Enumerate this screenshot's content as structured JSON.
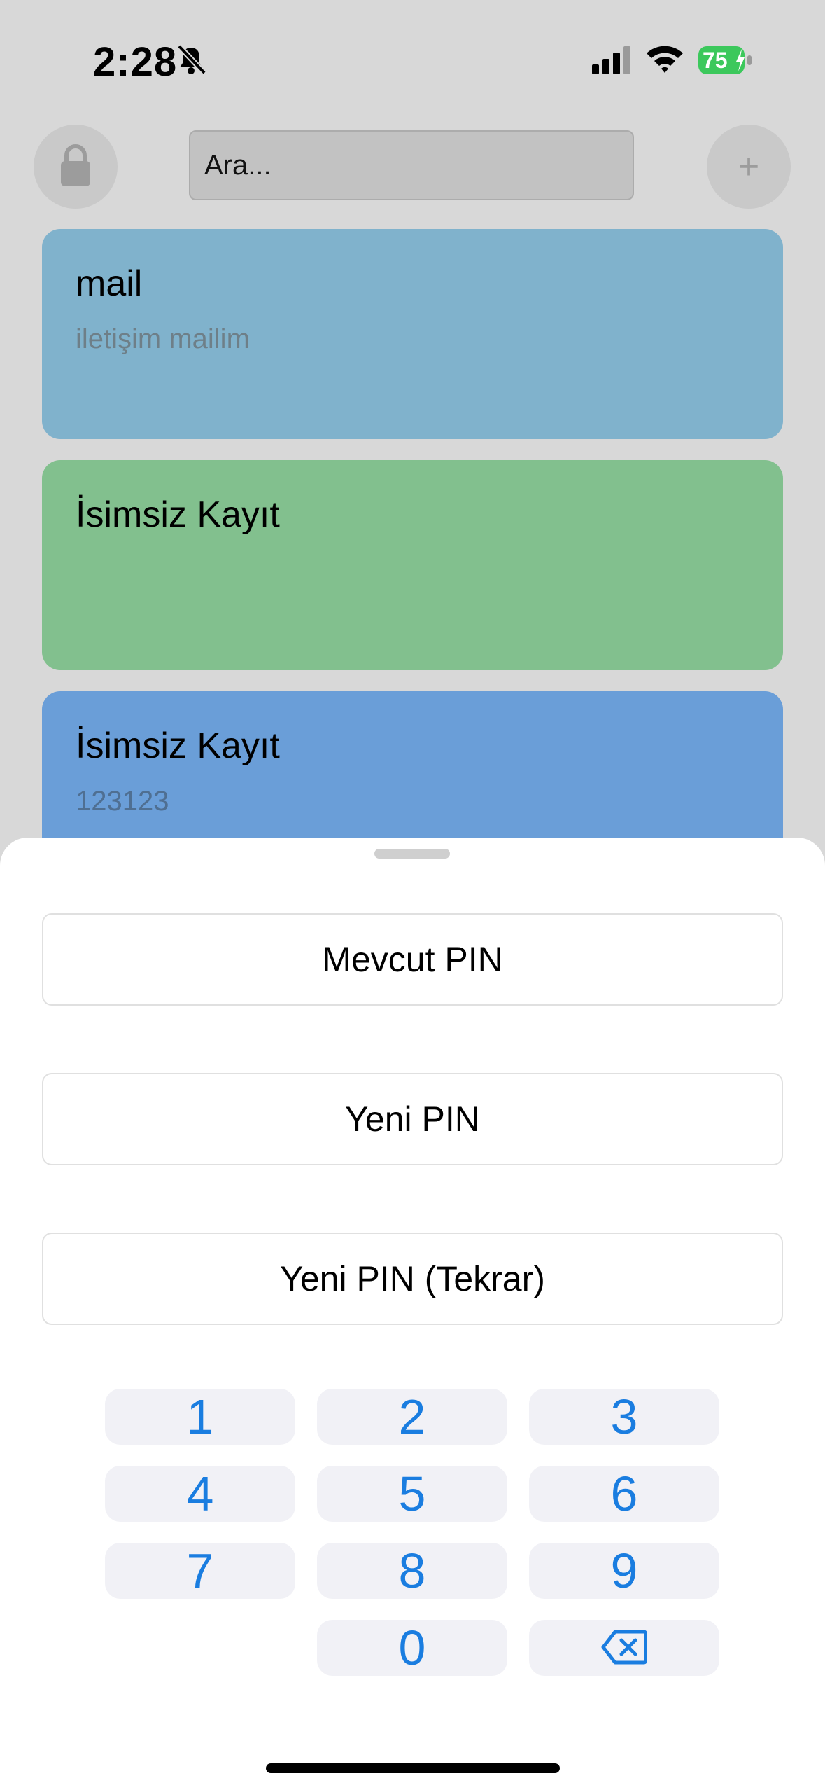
{
  "status_bar": {
    "time": "2:28",
    "battery_percent": "75",
    "battery_color": "#3cc85c"
  },
  "header": {
    "search_placeholder": "Ara...",
    "add_label": "+"
  },
  "records": [
    {
      "title": "mail",
      "subtitle": "iletişim mailim",
      "color": "#80b2cc"
    },
    {
      "title": "İsimsiz Kayıt",
      "subtitle": "",
      "color": "#82c08e"
    },
    {
      "title": "İsimsiz Kayıt",
      "subtitle": "123123",
      "color": "#6a9ed8"
    }
  ],
  "pin_sheet": {
    "current_pin": "Mevcut PIN",
    "new_pin": "Yeni PIN",
    "new_pin_repeat": "Yeni PIN (Tekrar)"
  },
  "keypad": {
    "keys": [
      "1",
      "2",
      "3",
      "4",
      "5",
      "6",
      "7",
      "8",
      "9",
      "0"
    ],
    "accent": "#1a7de0"
  }
}
